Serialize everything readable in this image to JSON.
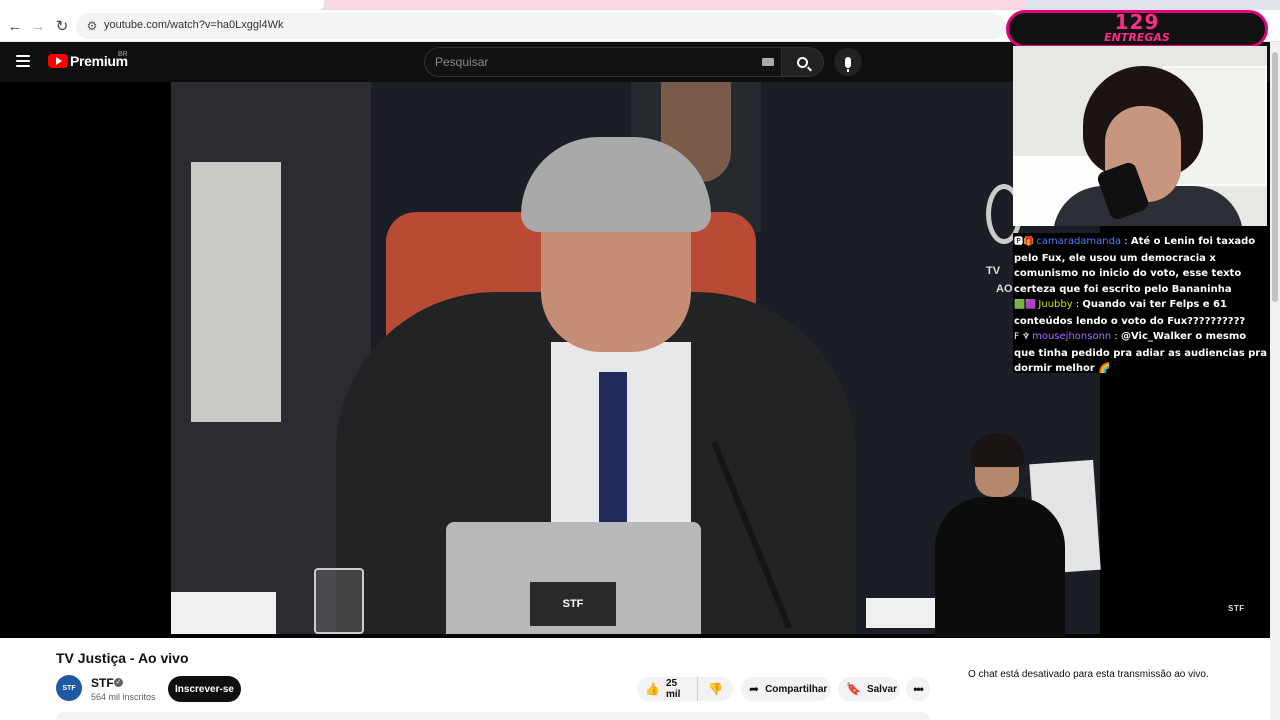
{
  "browser": {
    "url": "youtube.com/watch?v=ha0Lxggl4Wk"
  },
  "header": {
    "brand": "Premium",
    "region": "BR",
    "search_placeholder": "Pesquisar"
  },
  "player": {
    "laptop_logo": "STF",
    "side_logo_lines": [
      "TV",
      "AO"
    ],
    "watermark": "STF"
  },
  "overlay": {
    "counter_number": "129",
    "counter_label": "ENTREGAS",
    "chat": [
      {
        "badges": "🅿🎁",
        "user": "camaradamanda",
        "user_color": "#4f7fff",
        "text": "Até o Lenin foi taxado pelo Fux, ele usou um democracia x comunismo no inicio do voto, esse texto certeza que foi escrito pelo Bananinha"
      },
      {
        "badges": "🟩🟪",
        "user": "Juubby",
        "user_color": "#c8e000",
        "text": "Quando vai ter Felps e 61 conteúdos lendo o voto do Fux??????????"
      },
      {
        "badges": "F ♆",
        "user": "mousejhonsonn",
        "user_color": "#a86bff",
        "text": "@Vic_Walker o mesmo que tinha pedido pra adiar as audiencias pra dormir melhor 🌈"
      }
    ]
  },
  "video": {
    "title": "TV Justiça - Ao vivo",
    "channel_name": "STF",
    "channel_avatar": "STF",
    "subscribers": "564 mil inscritos",
    "subscribe_label": "Inscrever-se",
    "likes": "25 mil",
    "share_label": "Compartilhar",
    "save_label": "Salvar",
    "more_label": "•••"
  },
  "live_chat": {
    "disabled_message": "O chat está desativado para esta transmissão ao vivo."
  },
  "colors": {
    "header_bg": "#0f0f0f",
    "brand_red": "#ff0000",
    "counter_pink": "#ff2d8a"
  }
}
